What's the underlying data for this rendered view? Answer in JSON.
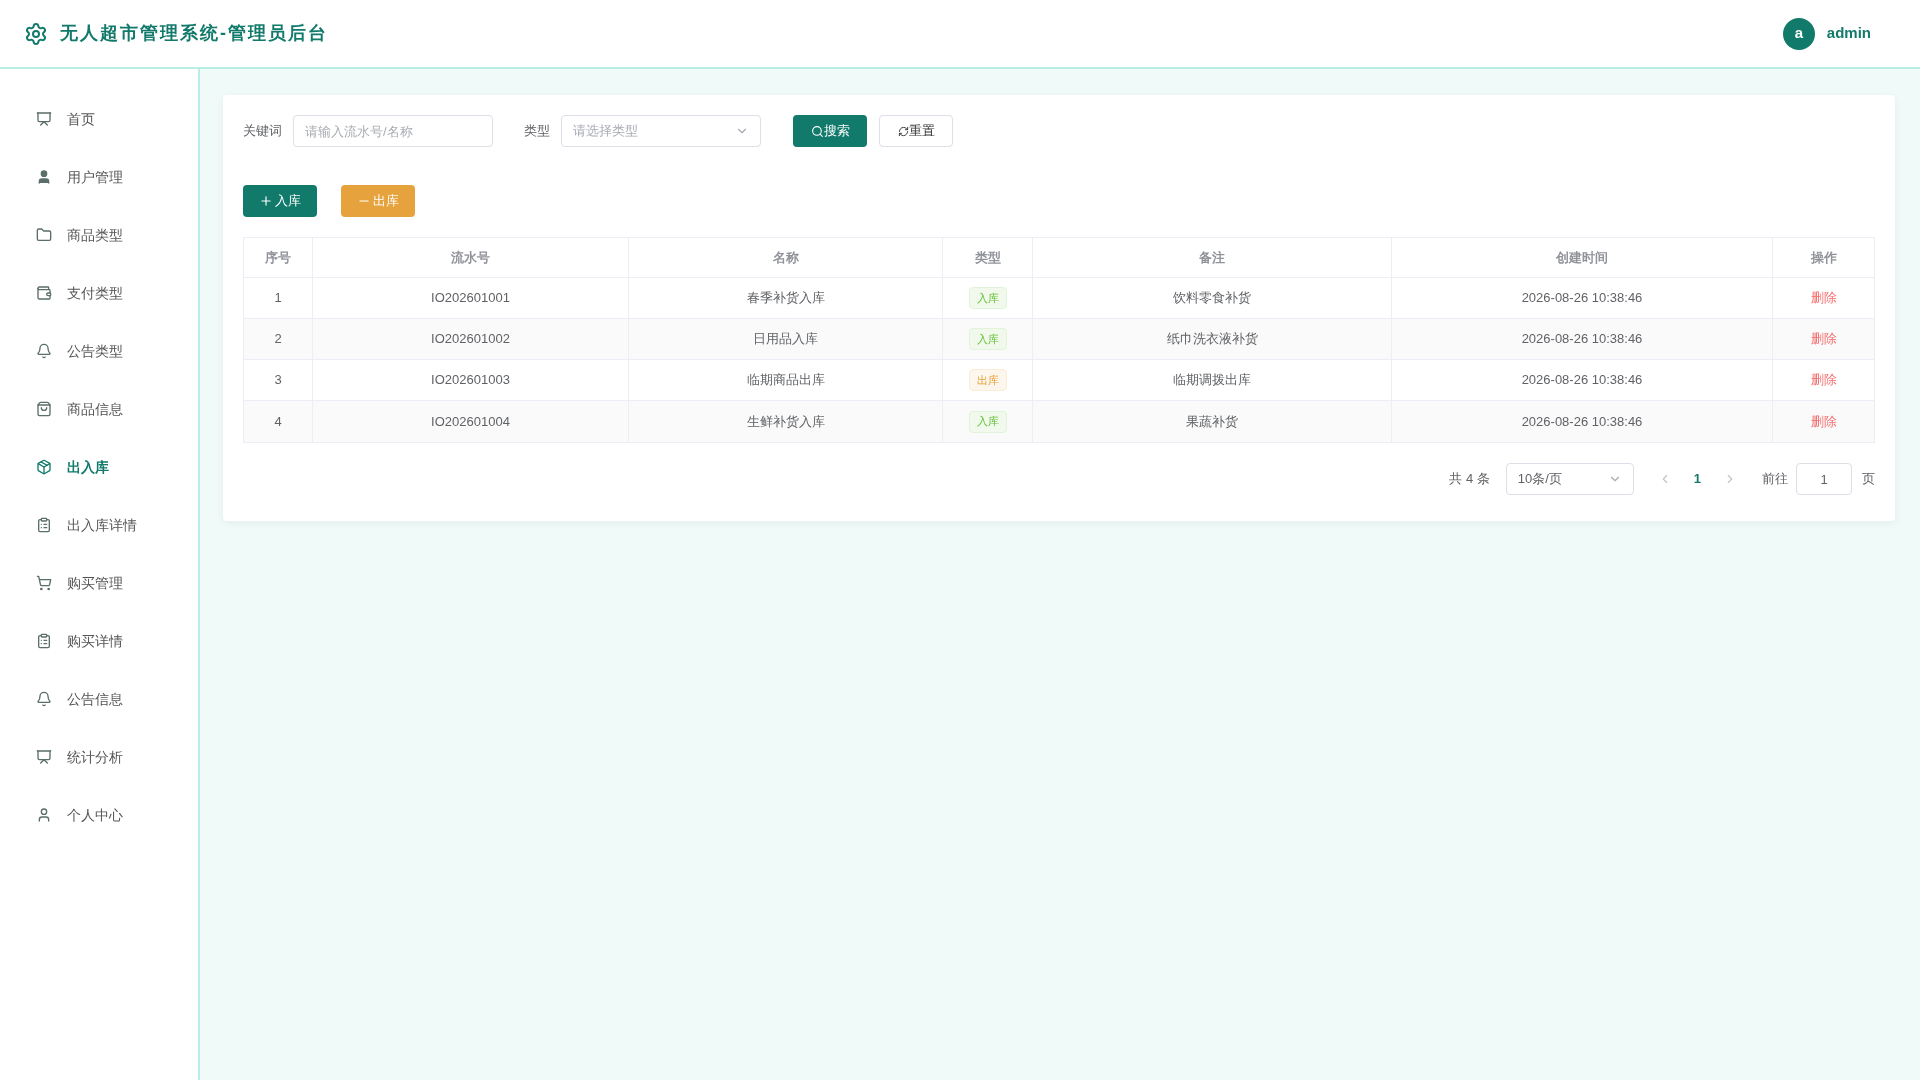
{
  "header": {
    "title": "无人超市管理系统-管理员后台",
    "user": {
      "avatar": "a",
      "name": "admin"
    }
  },
  "sidebar": {
    "items": [
      {
        "label": "首页",
        "selected": false
      },
      {
        "label": "用户管理",
        "selected": false
      },
      {
        "label": "商品类型",
        "selected": false
      },
      {
        "label": "支付类型",
        "selected": false
      },
      {
        "label": "公告类型",
        "selected": false
      },
      {
        "label": "商品信息",
        "selected": false
      },
      {
        "label": "出入库",
        "selected": true
      },
      {
        "label": "出入库详情",
        "selected": false
      },
      {
        "label": "购买管理",
        "selected": false
      },
      {
        "label": "购买详情",
        "selected": false
      },
      {
        "label": "公告信息",
        "selected": false
      },
      {
        "label": "统计分析",
        "selected": false
      },
      {
        "label": "个人中心",
        "selected": false
      }
    ]
  },
  "filters": {
    "keyword": {
      "label": "关键词",
      "placeholder": "请输入流水号/名称"
    },
    "type": {
      "label": "类型",
      "placeholder": "请选择类型"
    },
    "search_button": "搜索",
    "reset_button": "重置"
  },
  "actions": [
    {
      "label": "入库",
      "kind": "add"
    },
    {
      "label": "出库",
      "kind": "remove"
    }
  ],
  "table": {
    "columns": [
      "序号",
      "流水号",
      "名称",
      "类型",
      "备注",
      "创建时间",
      "操作"
    ],
    "rows": [
      {
        "index": "1",
        "serial": "IO202601001",
        "name": "春季补货入库",
        "type": {
          "label": "入库",
          "kind": "success"
        },
        "remark": "饮料零食补货",
        "created": "2026-08-26 10:38:46",
        "action": "删除"
      },
      {
        "index": "2",
        "serial": "IO202601002",
        "name": "日用品入库",
        "type": {
          "label": "入库",
          "kind": "success"
        },
        "remark": "纸巾洗衣液补货",
        "created": "2026-08-26 10:38:46",
        "action": "删除"
      },
      {
        "index": "3",
        "serial": "IO202601003",
        "name": "临期商品出库",
        "type": {
          "label": "出库",
          "kind": "warning"
        },
        "remark": "临期调拨出库",
        "created": "2026-08-26 10:38:46",
        "action": "删除"
      },
      {
        "index": "4",
        "serial": "IO202601004",
        "name": "生鲜补货入库",
        "type": {
          "label": "入库",
          "kind": "success"
        },
        "remark": "果蔬补货",
        "created": "2026-08-26 10:38:46",
        "action": "删除"
      }
    ]
  },
  "pagination": {
    "total": "共 4 条",
    "page_size": "10条/页",
    "pages": [
      {
        "label": "1",
        "selected": true
      }
    ],
    "goto_label": "前往",
    "goto_value": "1",
    "page_suffix": "页"
  }
}
